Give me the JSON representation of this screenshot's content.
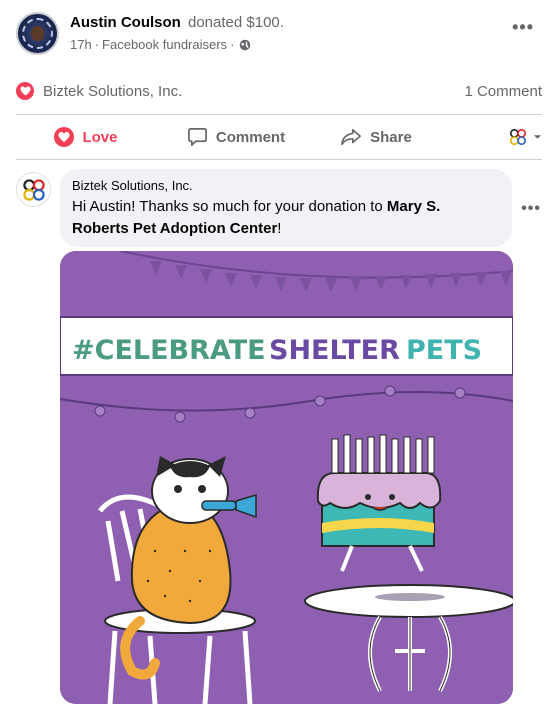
{
  "post": {
    "author": "Austin Coulson",
    "action": "donated $100.",
    "time": "17h",
    "separator": "·",
    "source": "Facebook fundraisers",
    "separator2": "·"
  },
  "summary": {
    "reactor": "Biztek Solutions, Inc.",
    "comments": "1 Comment"
  },
  "actions": {
    "love": "Love",
    "comment": "Comment",
    "share": "Share"
  },
  "comment": {
    "author": "Biztek Solutions, Inc.",
    "text_before": "Hi Austin! Thanks so much for your donation to ",
    "text_bold": "Mary S. Roberts Pet Adoption Center",
    "text_after": "!"
  },
  "image": {
    "banner_part1": "#CELEBRATE",
    "banner_part2": "SHELTER",
    "banner_part3": "PETS"
  },
  "colors": {
    "love": "#f33e58",
    "muted_text": "#65676b",
    "bubble": "#f0f2f5",
    "image_bg": "#8f5fb1",
    "banner_green": "#4a9b7f",
    "banner_purple": "#6b4aa3",
    "banner_teal": "#3fb3b0"
  },
  "icons": {
    "more": "more-horizontal-icon",
    "globe": "globe-icon",
    "love": "heart-icon",
    "comment": "speech-bubble-icon",
    "share": "share-arrow-icon",
    "page": "biztek-logo-icon",
    "dropdown": "caret-down-icon"
  }
}
